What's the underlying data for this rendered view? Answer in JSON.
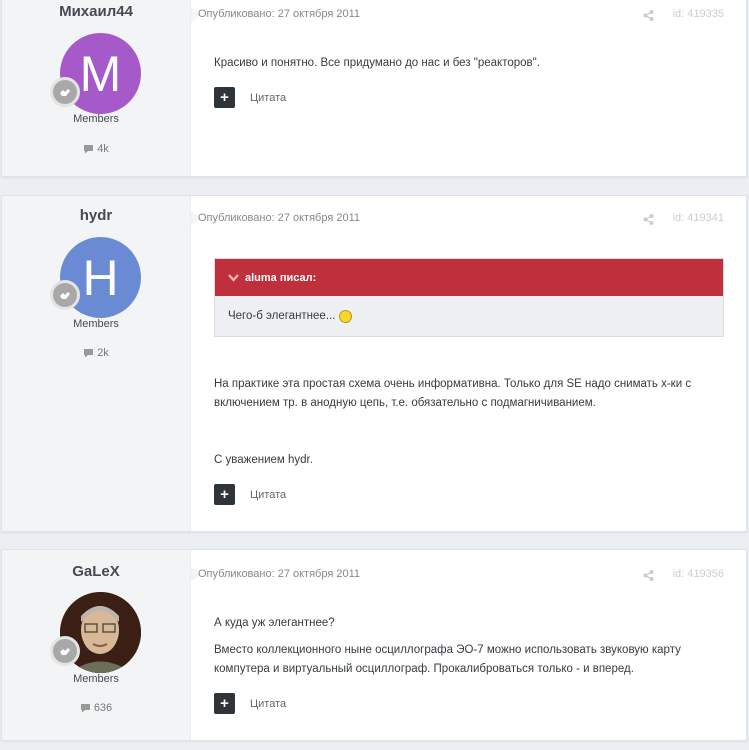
{
  "posts": [
    {
      "author": "Михаил44",
      "avatar_letter": "M",
      "avatar_color": "#a659c9",
      "role": "Members",
      "count": "4k",
      "published": "Опубликовано: 27 октября 2011",
      "post_id": "id: 419335",
      "paragraphs": [
        "Красиво и понятно. Все придумано до нас и без \"реакторов\"."
      ],
      "quote_label": "Цитата"
    },
    {
      "author": "hydr",
      "avatar_letter": "H",
      "avatar_color": "#6a8bd4",
      "role": "Members",
      "count": "2k",
      "published": "Опубликовано: 27 октября 2011",
      "post_id": "id: 419341",
      "citation": {
        "header": "aluma писал:",
        "body": "Чего-б элегантнее..."
      },
      "paragraphs": [
        "На практике эта простая схема очень информативна. Только для SE надо снимать х-ки с включением тр. в анодную цепь, т.е. обязательно с подмагничиванием.",
        "С уважением hydr."
      ],
      "quote_label": "Цитата"
    },
    {
      "author": "GaLeX",
      "role": "Members",
      "count": "636",
      "published": "Опубликовано: 27 октября 2011",
      "post_id": "id: 419356",
      "paragraphs": [
        "А куда уж элегантнее?",
        "Вместо коллекционного ныне осциллографа ЭО-7 можно использовать звуковую карту компутера и виртуальный осциллограф. Прокалиброваться только - и вперед."
      ],
      "quote_label": "Цитата"
    }
  ],
  "colors": {
    "citation_header": "#c0303c",
    "quote_button": "#2f3439"
  },
  "icons": [
    "badge-icon",
    "comment-icon",
    "share-icon",
    "plus-icon",
    "chevron-down-icon",
    "smiley-icon"
  ]
}
